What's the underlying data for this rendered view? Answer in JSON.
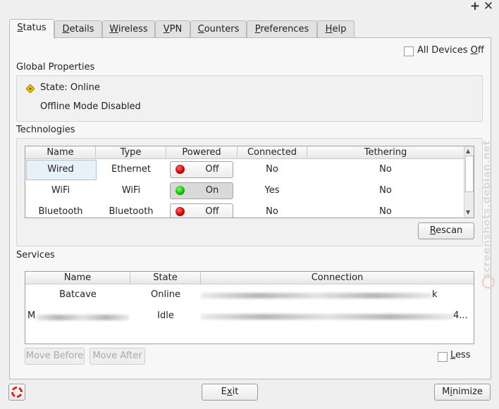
{
  "window": {
    "add_icon": "+",
    "close_icon": "✕"
  },
  "tabs": [
    {
      "key": "S",
      "rest": "tatus"
    },
    {
      "key": "D",
      "rest": "etails"
    },
    {
      "key": "W",
      "rest": "ireless"
    },
    {
      "key": "V",
      "rest": "PN"
    },
    {
      "key": "C",
      "rest": "ounters"
    },
    {
      "key": "P",
      "rest": "references"
    },
    {
      "key": "H",
      "rest": "elp"
    }
  ],
  "all_devices_off": {
    "pre": "All Devices ",
    "key": "O",
    "post": "ff",
    "checked": false
  },
  "global": {
    "title": "Global Properties",
    "state": "State: Online",
    "offline_mode": "Offline Mode Disabled",
    "state_icon": "warning-diamond-icon"
  },
  "technologies": {
    "title": "Technologies",
    "columns": [
      "Name",
      "Type",
      "Powered",
      "Connected",
      "Tethering"
    ],
    "rows": [
      {
        "name": "Wired",
        "type": "Ethernet",
        "powered": "Off",
        "power_color": "#cc0000",
        "connected": "No",
        "tethering": "No"
      },
      {
        "name": "WiFi",
        "type": "WiFi",
        "powered": "On",
        "power_color": "#16b000",
        "connected": "Yes",
        "tethering": "No"
      },
      {
        "name": "Bluetooth",
        "type": "Bluetooth",
        "powered": "Off",
        "power_color": "#cc0000",
        "connected": "No",
        "tethering": "No"
      }
    ],
    "rescan": {
      "key": "R",
      "rest": "escan"
    }
  },
  "services": {
    "title": "Services",
    "columns": [
      "Name",
      "State",
      "Connection"
    ],
    "rows": [
      {
        "name": "Batcave",
        "state": "Online",
        "connection_tail": "k"
      },
      {
        "name_prefix": "M",
        "state": "Idle",
        "connection_tail": "4..."
      }
    ],
    "move_before": "Move Before",
    "move_after": "Move After",
    "less": {
      "key": "L",
      "rest": "ess",
      "checked": false
    }
  },
  "footer": {
    "exit": {
      "pre": "E",
      "key": "x",
      "post": "it"
    },
    "minimize": {
      "pre": "M",
      "key": "i",
      "post": "nimize"
    },
    "help_icon": "lifebuoy-icon"
  },
  "watermark": "screenshots.debian.net"
}
